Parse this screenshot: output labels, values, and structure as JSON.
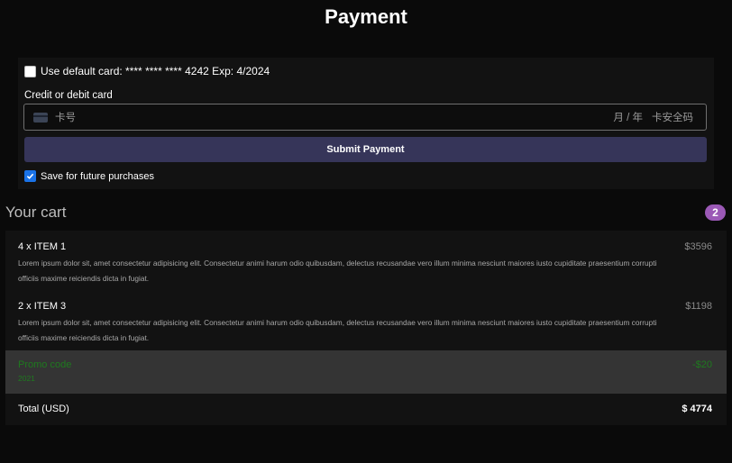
{
  "page": {
    "title": "Payment"
  },
  "payment": {
    "default_card_label": "Use default card: **** **** **** 4242 Exp: 4/2024",
    "default_card_checked": false,
    "card_label": "Credit or debit card",
    "card_number_placeholder": "卡号",
    "expiry_placeholder": "月 / 年",
    "cvc_placeholder": "卡安全码",
    "card_icon": "credit-card-icon",
    "submit_label": "Submit Payment",
    "submit_color": "#363559",
    "save_label": "Save for future purchases",
    "save_checked": true
  },
  "cart": {
    "title": "Your cart",
    "count": "2",
    "badge_color": "#9b59b6",
    "items": [
      {
        "name": "4 x ITEM 1",
        "description": "Lorem ipsum dolor sit, amet consectetur adipisicing elit. Consectetur animi harum odio quibusdam, delectus recusandae vero illum minima nesciunt maiores iusto cupiditate praesentium corrupti officiis maxime reiciendis dicta in fugiat.",
        "price": "$3596"
      },
      {
        "name": "2 x ITEM 3",
        "description": "Lorem ipsum dolor sit, amet consectetur adipisicing elit. Consectetur animi harum odio quibusdam, delectus recusandae vero illum minima nesciunt maiores iusto cupiditate praesentium corrupti officiis maxime reiciendis dicta in fugiat.",
        "price": "$1198"
      }
    ],
    "promo": {
      "label": "Promo code",
      "code": "2021",
      "amount": "-$20",
      "color": "#1e7a1e"
    },
    "total_label": "Total (USD)",
    "total_value": "$ 4774"
  }
}
